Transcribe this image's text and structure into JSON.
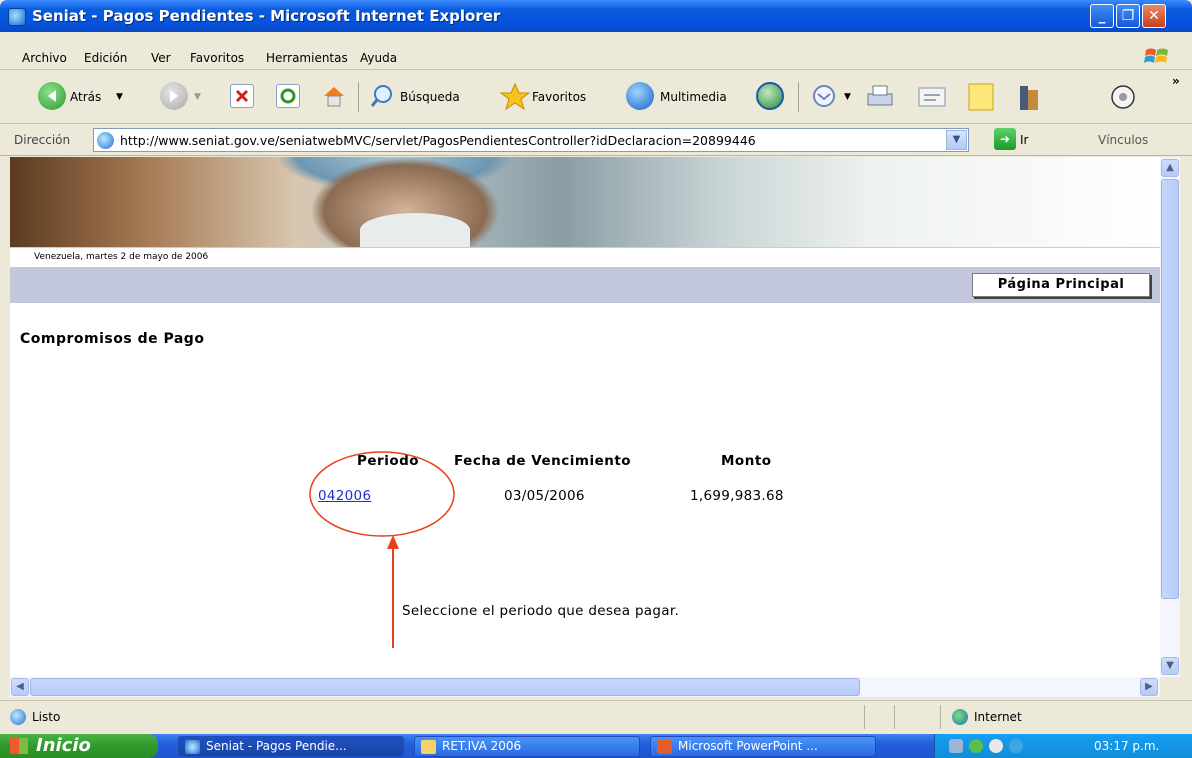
{
  "window": {
    "title": "Seniat - Pagos Pendientes - Microsoft Internet Explorer",
    "controls": {
      "minimize": "_",
      "maximize": "❐",
      "close": "✕"
    }
  },
  "menu": [
    "Archivo",
    "Edición",
    "Ver",
    "Favoritos",
    "Herramientas",
    "Ayuda"
  ],
  "toolbar": {
    "back": "Atrás",
    "search": "Búsqueda",
    "favorites": "Favoritos",
    "media": "Multimedia"
  },
  "address": {
    "label": "Dirección",
    "url": "http://www.seniat.gov.ve/seniatwebMVC/servlet/PagosPendientesController?idDeclaracion=20899446",
    "go": "Ir",
    "links": "Vínculos"
  },
  "page": {
    "date": "Venezuela, martes 2 de mayo de 2006",
    "home_button": "Página Principal",
    "title": "Compromisos de Pago",
    "table": {
      "headers": [
        "Periodo",
        "Fecha de Vencimiento",
        "Monto"
      ],
      "rows": [
        {
          "period": "042006",
          "due_date": "03/05/2006",
          "amount": "1,699,983.68"
        }
      ]
    },
    "hint": "Seleccione el periodo que desea pagar.",
    "annotation_color": "#e8401a"
  },
  "status": {
    "text": "Listo",
    "zone": "Internet"
  },
  "taskbar": {
    "start": "Inicio",
    "tasks": [
      "Seniat - Pagos Pendie...",
      "RET.IVA 2006",
      "Microsoft PowerPoint ..."
    ],
    "clock": "03:17 p.m."
  }
}
